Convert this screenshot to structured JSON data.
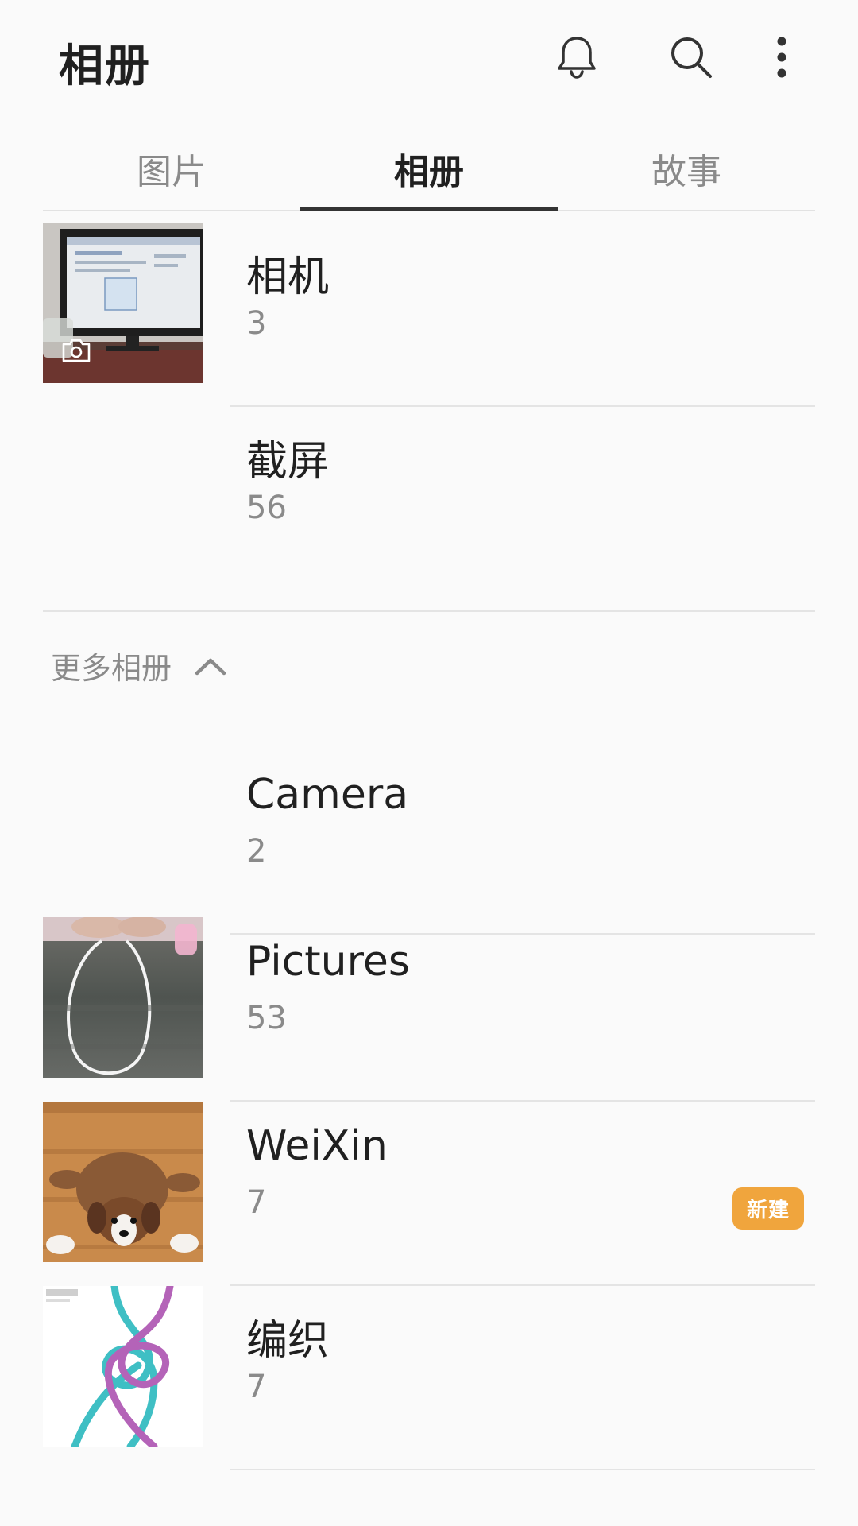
{
  "header": {
    "title": "相册",
    "icons": [
      "bell-icon",
      "search-icon",
      "more-vert-icon"
    ]
  },
  "tabs": [
    {
      "label": "图片",
      "active": false
    },
    {
      "label": "相册",
      "active": true
    },
    {
      "label": "故事",
      "active": false
    }
  ],
  "albums": [
    {
      "name": "相机",
      "count": "3",
      "thumb": "monitor-photo",
      "overlay_icon": "camera-icon"
    },
    {
      "name": "截屏",
      "count": "56",
      "thumb": "blank"
    }
  ],
  "more_section": {
    "label": "更多相册",
    "icon": "chevron-up-icon"
  },
  "more_albums": [
    {
      "name": "Camera",
      "count": "2",
      "thumb": "blank"
    },
    {
      "name": "Pictures",
      "count": "53",
      "thumb": "string-photo"
    },
    {
      "name": "WeiXin",
      "count": "7",
      "thumb": "puppy-photo",
      "badge": "新建"
    },
    {
      "name": "编织",
      "count": "7",
      "thumb": "knot-photo"
    }
  ],
  "colors": {
    "background": "#fafafa",
    "badge": "#f0a53d",
    "muted_text": "#8a8a8a",
    "active_tab_underline": "#333333"
  }
}
